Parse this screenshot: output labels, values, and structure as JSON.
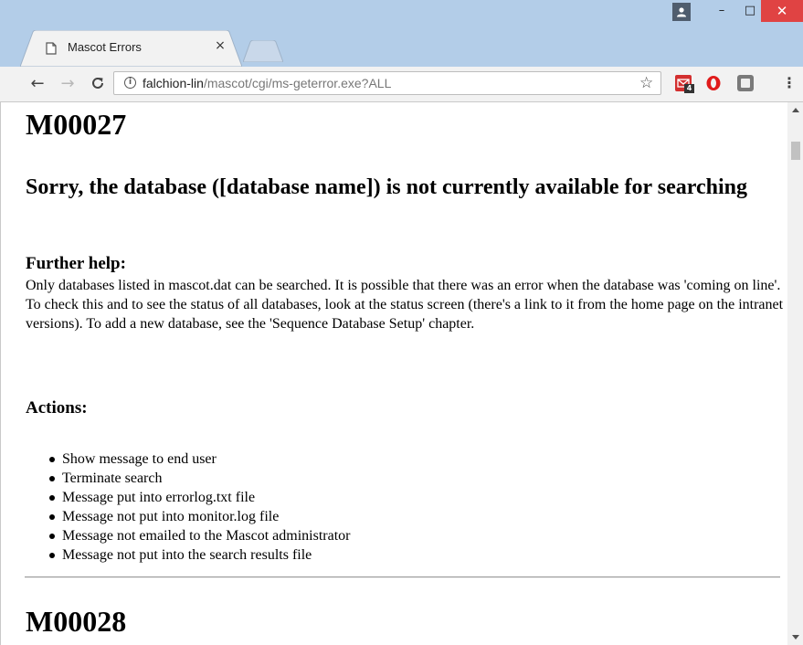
{
  "window": {
    "profile_icon": "person-icon",
    "minimize": "–",
    "maximize": "□",
    "close": "✕"
  },
  "tab": {
    "title": "Mascot Errors",
    "close": "×"
  },
  "toolbar": {
    "back": "←",
    "forward": "→",
    "reload": "C",
    "url_host": "falchion-lin",
    "url_path": "/mascot/cgi/ms-geterror.exe?ALL",
    "star": "☆",
    "ext_mail_badge": "4",
    "menu": "⋮"
  },
  "content": {
    "code1": "M00027",
    "message": "Sorry, the database ([database name]) is not currently available for searching",
    "further_help_heading": "Further help:",
    "further_help_text": "Only databases listed in mascot.dat can be searched. It is possible that there was an error when the database was 'coming on line'. To check this and to see the status of all databases, look at the status screen (there's a link to it from the home page on the intranet versions). To add a new database, see the 'Sequence Database Setup' chapter.",
    "actions_heading": "Actions:",
    "actions": [
      "Show message to end user",
      "Terminate search",
      "Message put into errorlog.txt file",
      "Message not put into monitor.log file",
      "Message not emailed to the Mascot administrator",
      "Message not put into the search results file"
    ],
    "code2": "M00028"
  },
  "colors": {
    "titlebar": "#b3cde8",
    "close_button": "#e04343",
    "toolbar": "#f2f2f2"
  }
}
